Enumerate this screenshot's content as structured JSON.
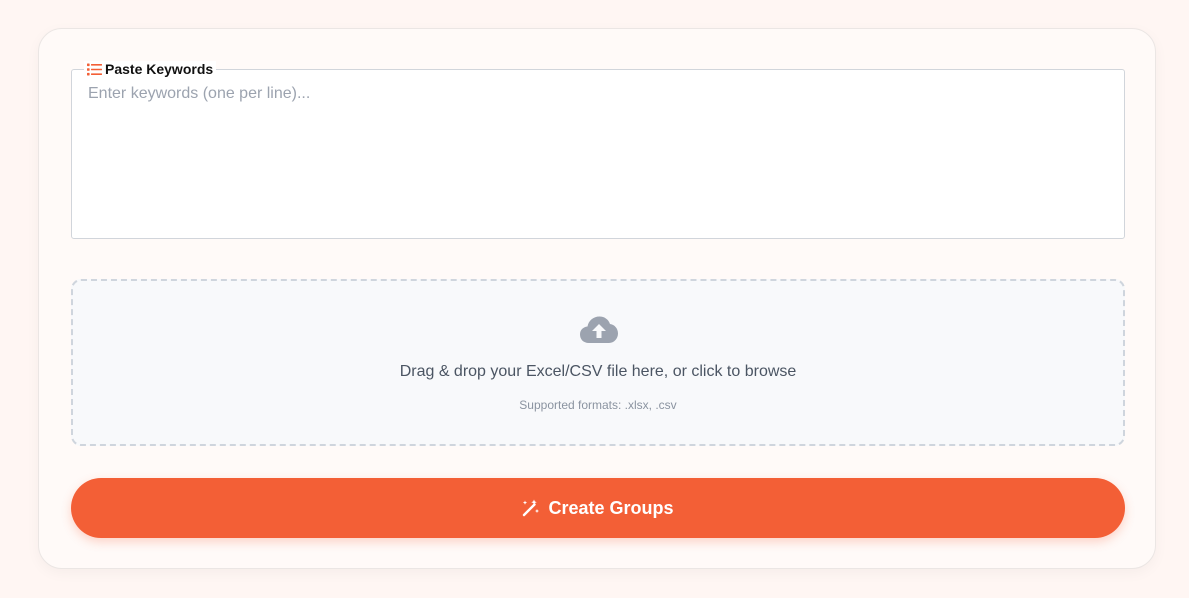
{
  "keywords": {
    "label": "Paste Keywords",
    "placeholder": "Enter keywords (one per line)...",
    "value": "",
    "icon": "list-icon"
  },
  "upload": {
    "icon": "cloud-upload-icon",
    "prompt": "Drag & drop your Excel/CSV file here, or click to browse",
    "formats": "Supported formats: .xlsx, .csv"
  },
  "action": {
    "label": "Create Groups",
    "icon": "magic-wand-icon"
  },
  "colors": {
    "accent": "#f35f36",
    "page_background": "#fff6f3",
    "muted_icon": "#9ca3af"
  }
}
